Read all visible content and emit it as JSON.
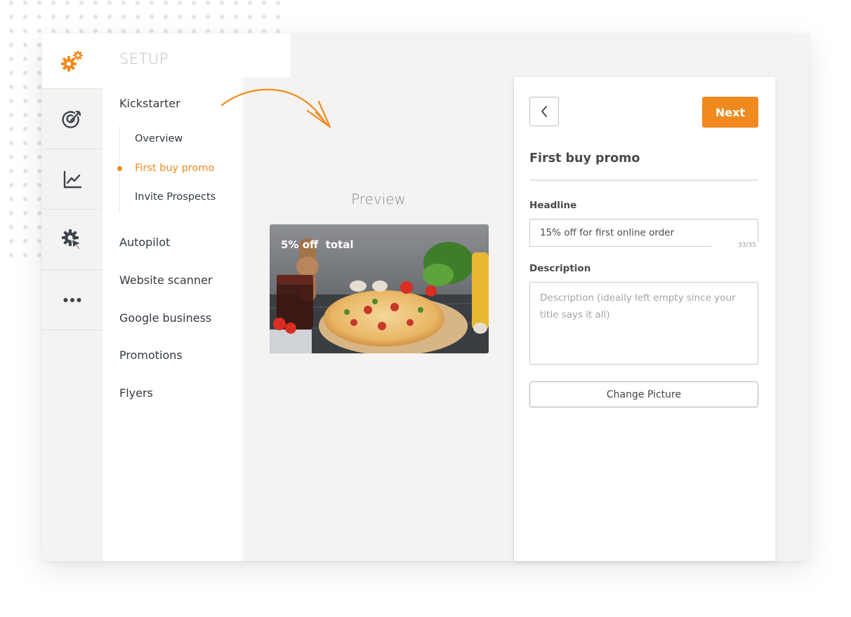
{
  "colors": {
    "accent": "#f08a1e",
    "nav_text": "#333a44",
    "header_muted": "#bdbdbd",
    "app_background": "#f4f3f1"
  },
  "rail": {
    "top_icon": "gears-icon",
    "items": [
      {
        "icon": "target-icon"
      },
      {
        "icon": "chart-line-icon"
      },
      {
        "icon": "settings-cursor-icon"
      },
      {
        "icon": "more-dots-icon"
      }
    ]
  },
  "nav": {
    "header": "SETUP",
    "kickstarter": "Kickstarter",
    "sub_items": [
      "Overview",
      "First buy promo",
      "Invite Prospects"
    ],
    "active_sub_item": "First buy promo",
    "items": [
      "Autopilot",
      "Website scanner",
      "Google business",
      "Promotions",
      "Flyers"
    ]
  },
  "preview": {
    "title": "Preview",
    "promo_text": "5% off  total",
    "image_subject": "pizza photo"
  },
  "form": {
    "back_icon": "chevron-left-icon",
    "next_label": "Next",
    "title": "First buy promo",
    "headline_label": "Headline",
    "headline_value": "15% off for first online order",
    "headline_counter": "33/35",
    "description_label": "Description",
    "description_placeholder": "Description (ideally left empty since your title says it all)",
    "change_picture_label": "Change Picture"
  }
}
